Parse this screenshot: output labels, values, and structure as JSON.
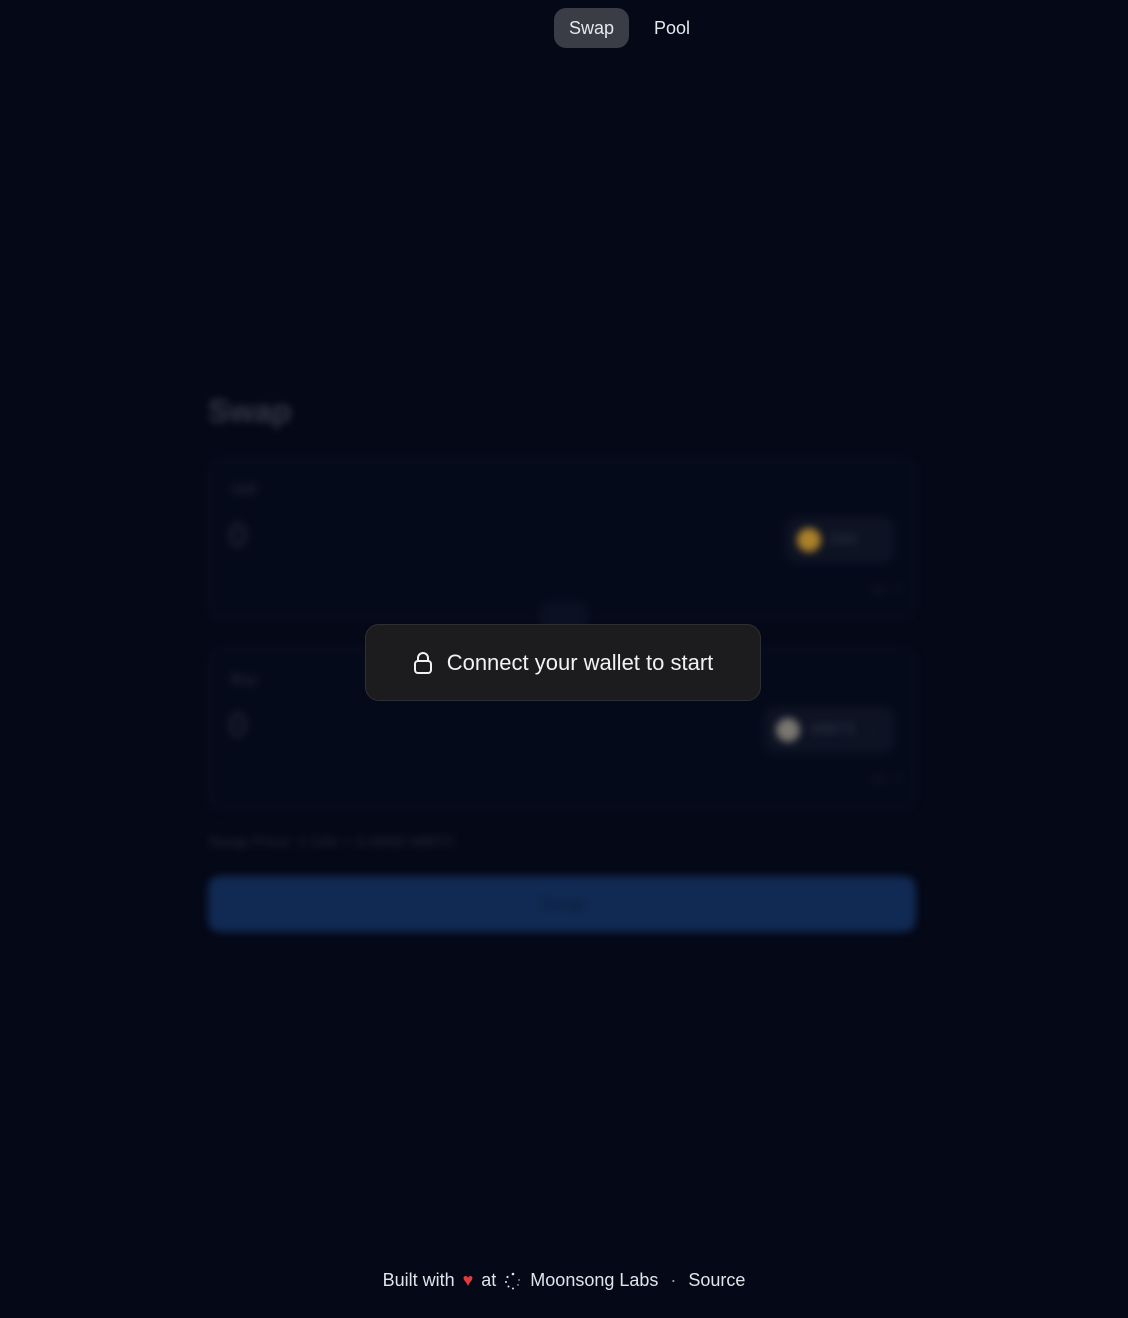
{
  "nav": {
    "tabs": [
      {
        "label": "Swap",
        "active": true
      },
      {
        "label": "Pool",
        "active": false
      }
    ]
  },
  "swap": {
    "title": "Swap",
    "sell": {
      "label": "Sell",
      "amount": "0",
      "token": "DAI",
      "token_color": "#c9962d"
    },
    "buy": {
      "label": "Buy",
      "amount": "0",
      "token": "WBTC",
      "token_color": "#8f8a80"
    },
    "price_text": "Swap Price: 1 DAI = 0.0000 WBTC",
    "swap_button": "Swap"
  },
  "overlay": {
    "message": "Connect your wallet to start"
  },
  "footer": {
    "built_with": "Built with",
    "at": "at",
    "company": "Moonsong Labs",
    "separator": "·",
    "source": "Source"
  },
  "colors": {
    "background": "#040817",
    "accent": "#14305e",
    "heart": "#e23b3b"
  }
}
